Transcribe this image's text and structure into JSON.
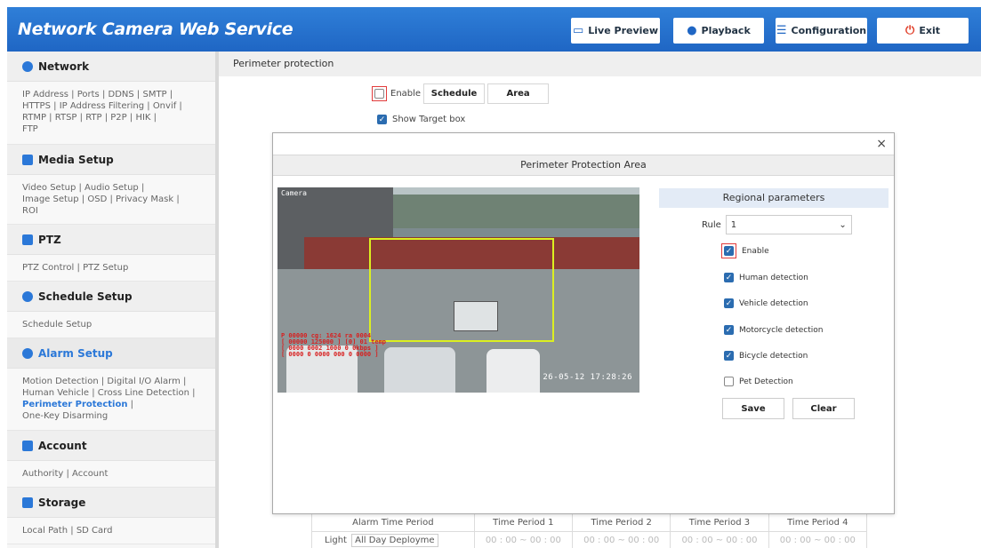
{
  "header": {
    "title": "Network Camera Web Service",
    "buttons": {
      "live_preview": "Live Preview",
      "playback": "Playback",
      "configuration": "Configuration",
      "exit": "Exit"
    }
  },
  "sidebar": {
    "sections": [
      {
        "title": "Network",
        "links": [
          "IP Address",
          "Ports",
          "DDNS",
          "SMTP",
          "HTTPS",
          "IP Address Filtering",
          "Onvif",
          "RTMP",
          "RTSP",
          "RTP",
          "P2P",
          "HIK",
          "FTP"
        ]
      },
      {
        "title": "Media Setup",
        "links": [
          "Video Setup",
          "Audio Setup",
          "Image Setup",
          "OSD",
          "Privacy Mask",
          "ROI"
        ]
      },
      {
        "title": "PTZ",
        "links": [
          "PTZ Control",
          "PTZ Setup"
        ]
      },
      {
        "title": "Schedule Setup",
        "links": [
          "Schedule Setup"
        ]
      },
      {
        "title": "Alarm Setup",
        "links": [
          "Motion Detection",
          "Digital I/O Alarm",
          "Human Vehicle",
          "Cross Line Detection",
          "Perimeter Protection",
          "One-Key Disarming"
        ],
        "active_link": "Perimeter Protection"
      },
      {
        "title": "Account",
        "links": [
          "Authority",
          "Account"
        ]
      },
      {
        "title": "Storage",
        "links": [
          "Local Path",
          "SD Card"
        ]
      }
    ]
  },
  "page": {
    "breadcrumb": "Perimeter protection",
    "enable_label": "Enable",
    "enable_checked": false,
    "schedule_button": "Schedule",
    "area_button": "Area",
    "show_target_label": "Show Target box",
    "show_target_checked": true
  },
  "schedule_table": {
    "headers": [
      "Alarm Time Period",
      "Time Period 1",
      "Time Period 2",
      "Time Period 3",
      "Time Period 4"
    ],
    "row": {
      "label": "Light",
      "select_value": "All Day Deployme",
      "period": "00 : 00 ~ 00 : 00"
    }
  },
  "modal": {
    "close": "×",
    "title": "Perimeter Protection Area",
    "camera": {
      "label": "Camera",
      "timestamp": "26-05-12 17:28:26",
      "detections": [
        "P 00000 cg: 1624 ra 0004",
        "[ 00000 125000 ] [0] 01 temp",
        "[ 0000 0002 1000 0 0kbps ]",
        "[ 0000 0 0000 000 0 0000 ]"
      ]
    },
    "params": {
      "title": "Regional parameters",
      "rule_label": "Rule",
      "rule_value": "1",
      "options": [
        {
          "label": "Enable",
          "checked": true
        },
        {
          "label": "Human detection",
          "checked": true
        },
        {
          "label": "Vehicle detection",
          "checked": true
        },
        {
          "label": "Motorcycle detection",
          "checked": true
        },
        {
          "label": "Bicycle detection",
          "checked": true
        },
        {
          "label": "Pet Detection",
          "checked": false
        }
      ],
      "save": "Save",
      "clear": "Clear"
    }
  },
  "colors": {
    "header_blue": "#1f66c4",
    "accent_blue": "#2b78d8",
    "highlight_red": "#e23c3c",
    "detection_box": "#dcef20"
  }
}
